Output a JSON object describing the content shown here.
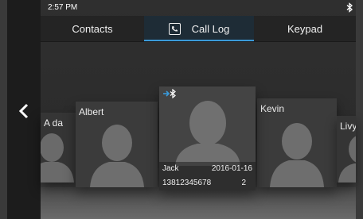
{
  "status_bar": {
    "time": "2:57 PM",
    "bluetooth_icon": "bluetooth-icon"
  },
  "tabs": [
    {
      "label": "Contacts",
      "active": false
    },
    {
      "label": "Call Log",
      "active": true,
      "icon": "phone-icon"
    },
    {
      "label": "Keypad",
      "active": false
    }
  ],
  "navigation": {
    "back_icon": "chevron-left-icon"
  },
  "cards": [
    {
      "name": "A da",
      "avatar": "person-silhouette-icon"
    },
    {
      "name": "Albert",
      "avatar": "person-silhouette-icon"
    },
    {
      "name": "Jack",
      "date": "2016-01-16",
      "phone": "13812345678",
      "count": "2",
      "call_type_icon": "bluetooth-incoming-icon",
      "selected": true,
      "avatar": "person-silhouette-icon"
    },
    {
      "name": "Kevin",
      "avatar": "person-silhouette-icon"
    },
    {
      "name": "Livy",
      "avatar": "person-silhouette-icon"
    }
  ],
  "colors": {
    "accent": "#3a9ad9",
    "background": "#2b2b2b",
    "tab_bar": "#242424",
    "card": "#3b3b3b"
  }
}
